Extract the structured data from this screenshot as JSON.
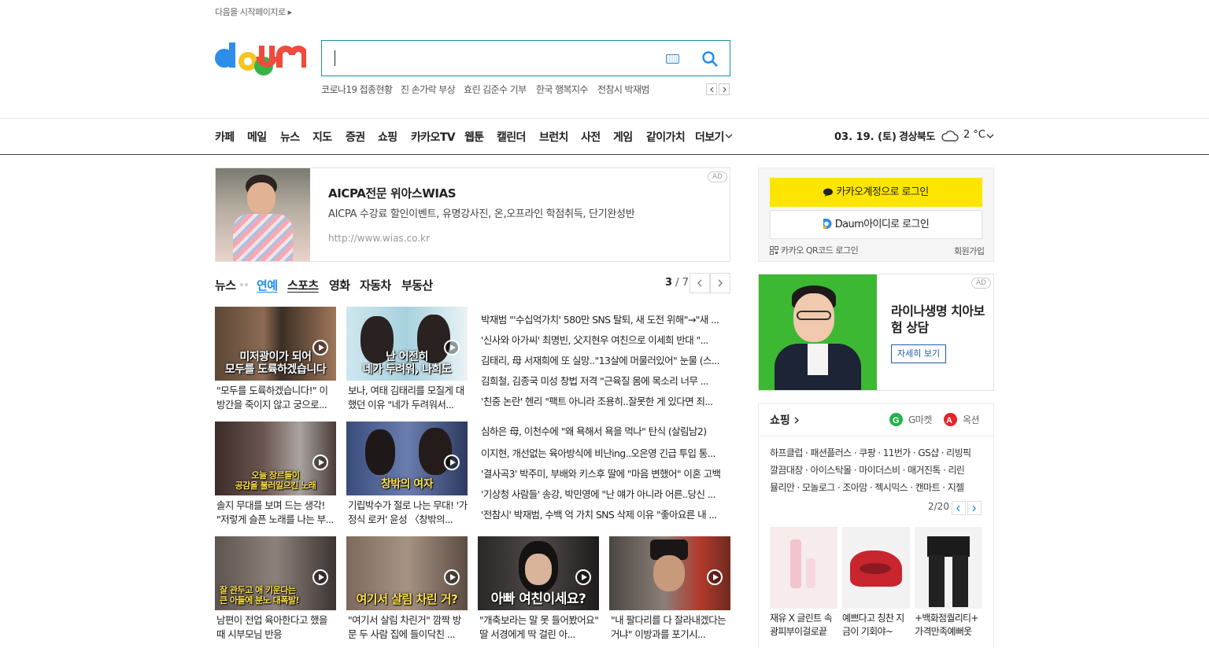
{
  "header": {
    "start_page": "다음을 시작페이지로",
    "start_arrow": "▸",
    "keywords": [
      "코로나19 접종현황",
      "진 손가락 부상",
      "효린 김준수 기부",
      "한국 행복지수",
      "전참시 박재범"
    ]
  },
  "gnb": {
    "items": [
      "카페",
      "메일",
      "뉴스",
      "지도",
      "증권",
      "쇼핑",
      "카카오TV",
      "웹툰",
      "캘린더",
      "브런치",
      "사전",
      "게임",
      "같이가치",
      "더보기"
    ],
    "date": "03. 19. (토)",
    "region": "경상북도",
    "temp": "2 °C"
  },
  "ad1": {
    "title": "AICPA전문 위아스WIAS",
    "desc": "AICPA 수강료 할인이벤트, 유명강사진, 온,오프라인 학점취득, 단기완성반",
    "url": "http://www.wias.co.kr",
    "tag": "AD"
  },
  "news": {
    "tabs": [
      "뉴스",
      "연예",
      "스포츠",
      "영화",
      "자동차",
      "부동산"
    ],
    "page_current": "3",
    "page_total": " / 7",
    "thumbs": [
      {
        "caption": "미저광이가 되어\n모두를 도륙하겠습니다",
        "title": "\"모두를 도륙하겠습니다!\" 이방간을 죽이지 않고 궁으로..."
      },
      {
        "caption": "난 어전히\n네가 두려워, 나희도",
        "title": "보나, 여태 김태리를 모질게 대했던 이유 \"네가 두려워서..."
      },
      {
        "caption": "오늘 장르들이\n공감을 불러일으킨 노래",
        "title": "솔지 무대를 보며 드는 생각! \"저렇게 슬픈 노래를 나는 부..."
      },
      {
        "caption": "창밖의 여자",
        "title": "기립박수가 절로 나는 무대! '가정식 로커' 윤성 〈창밖의..."
      },
      {
        "caption": "잘 관두고 애 키운다는\n큰 아들에 분노 대폭발!",
        "title": "남편이 전업 육아한다고 했을 때 시부모님 반응"
      },
      {
        "caption": "여기서 살림 차린 거?",
        "title": "\"여기서 살림 차린거\" 깜짝 방문 두 사람 집에 들이닥친 ..."
      },
      {
        "caption": "아빠 여친이세요?",
        "title": "\"개축보라는 말 못 들어봤어요\" 딸 서경에게 딱 걸린 아..."
      },
      {
        "caption": "",
        "title": "\"내 팔다리를 다 잘라내겠다는 거냐\" 이방과를 포기시..."
      }
    ],
    "headlines_a": [
      "박재범 \"'수십억가치' 580만 SNS 탈퇴, 새 도전 위해\"→\"새 ...",
      "'신사와 아가씨' 최명빈, 父지현우 여친으로 이세희 반대 \"...",
      "김태리, 母 서재희에 또 실망..\"13살에 머물러있어\" 눈물 (스...",
      "김희철, 김종국 미성 창법 저격 \"근육질 몸에 목소리 너무 ...",
      "'친중 논란' 헨리 \"팩트 아니라 조용히..잘못한 게 있다면 죄..."
    ],
    "headlines_b": [
      "심하은 母, 이천수에 \"왜 욕해서 욕을 먹나\" 탄식 (살림남2)",
      "이지현, 개선없는 육아방식에 비난ing..오은영 긴급 투입 통...",
      "'결사곡3' 박주미, 부배와 키스후 딸에 \"마음 변했어\" 이혼 고백",
      "'기상청 사람들' 송강, 박민영에 \"난 얘가 아니라 어른..당신 ...",
      "'전참시' 박재범, 수백 억 가치 SNS 삭제 이유 \"좋아요른 내 ..."
    ]
  },
  "login": {
    "kakao": "카카오계정으로 로그인",
    "daum": "Daum아이디로 로그인",
    "qr": "카카오 QR코드 로그인",
    "join": "회원가입"
  },
  "ad2": {
    "title": "라이나생명 치아보험 상담",
    "button": "자세히 보기",
    "tag": "AD"
  },
  "shopping": {
    "title": "쇼핑",
    "gmarket": "G마켓",
    "auction": "옥션",
    "lines": [
      "하프클럽 · 패션플러스 · 쿠팡 · 11번가 · GS샵 · 리빙픽",
      "깔끔대장 · 아이스탁몰 · 마이더스비 · 매거진톡 · 리린",
      "뮬리안 · 모놀로그 · 조아맘 · 젝시믹스 · 캔마트 · 지젤"
    ],
    "page": "2/20",
    "products": [
      {
        "title": "재유 X 글린트 속광피부이걸로끝"
      },
      {
        "title": "예쁘다고 칭찬 지금이 기회야~"
      },
      {
        "title": "+백화점퀄리티+ 가격만족예뻐옷"
      }
    ]
  },
  "colors": {
    "brand_teal": "#1b8fa1",
    "active_tab": "#1d8cee",
    "kakao_yellow": "#fee500",
    "ad_green": "#3db833"
  }
}
